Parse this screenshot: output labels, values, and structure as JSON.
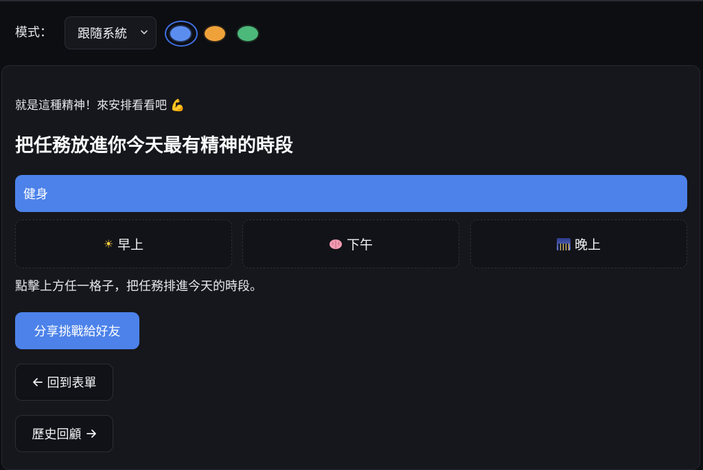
{
  "toolbar": {
    "mode_label": "模式：",
    "mode_value": "跟隨系統",
    "themes": [
      {
        "name": "blue",
        "color": "#5b8def",
        "selected": true
      },
      {
        "name": "orange",
        "color": "#f0a23a",
        "selected": false
      },
      {
        "name": "green",
        "color": "#4cb87a",
        "selected": false
      }
    ]
  },
  "main": {
    "encouragement": "就是這種精神！來安排看看吧 💪",
    "heading": "把任務放進你今天最有精神的時段",
    "task": "健身",
    "slots": [
      {
        "icon": "sun-icon",
        "label": "早上"
      },
      {
        "icon": "brain-icon",
        "label": "下午"
      },
      {
        "icon": "night-city-icon",
        "label": "晚上"
      }
    ],
    "hint": "點擊上方任一格子，把任務排進今天的時段。",
    "share_label": "分享挑戰給好友",
    "back_label": "回到表單",
    "history_label": "歷史回顧"
  },
  "colors": {
    "accent": "#4c82ea",
    "background": "#0d0e12",
    "card": "#16171c"
  }
}
